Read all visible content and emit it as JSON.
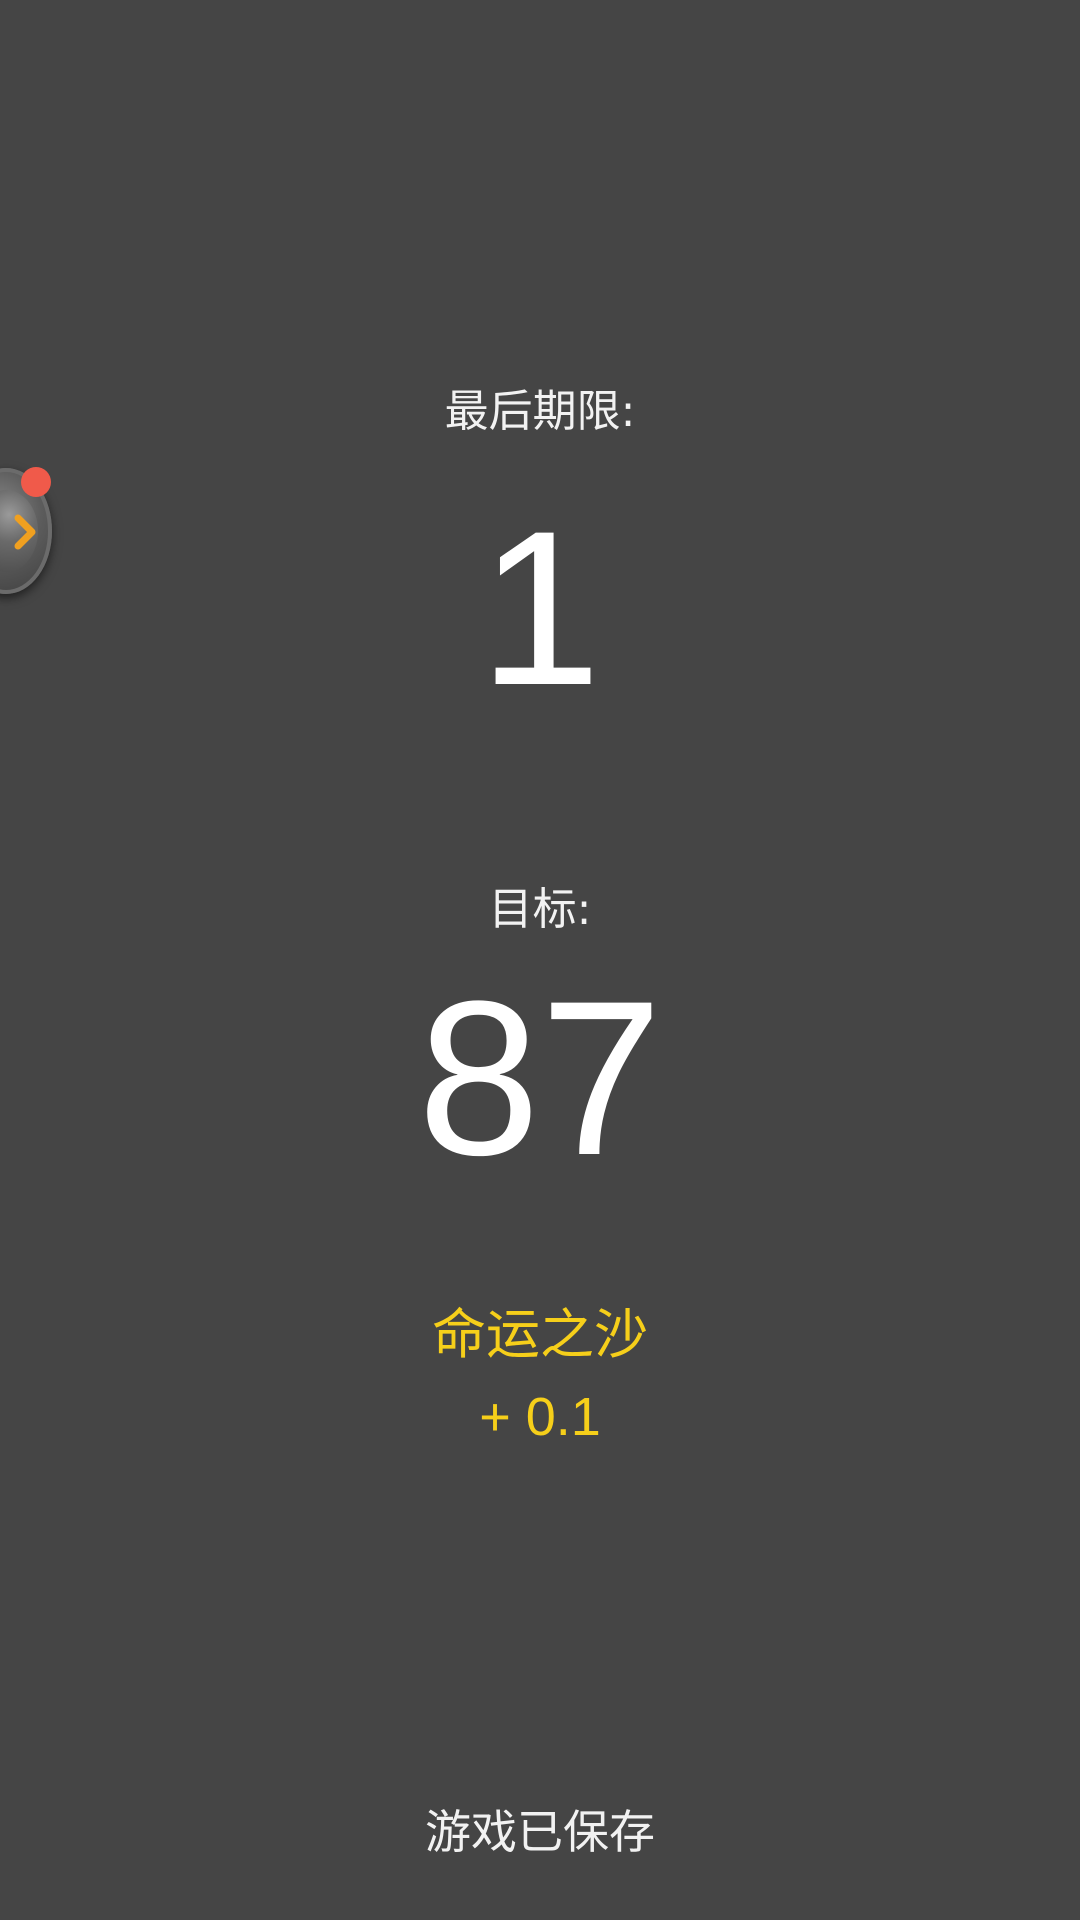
{
  "deadline": {
    "label": "最后期限:",
    "value": "1"
  },
  "target": {
    "label": "目标:",
    "value": "87"
  },
  "bonus": {
    "name": "命运之沙",
    "value": "+ 0.1"
  },
  "status": {
    "saved": "游戏已保存"
  },
  "floating_button": {
    "icon": "chevron-right-icon",
    "has_notification": true
  },
  "colors": {
    "background": "#454545",
    "accent_yellow": "#f6cf1a",
    "notification_red": "#f05a4a",
    "chevron_orange": "#f0a020"
  }
}
